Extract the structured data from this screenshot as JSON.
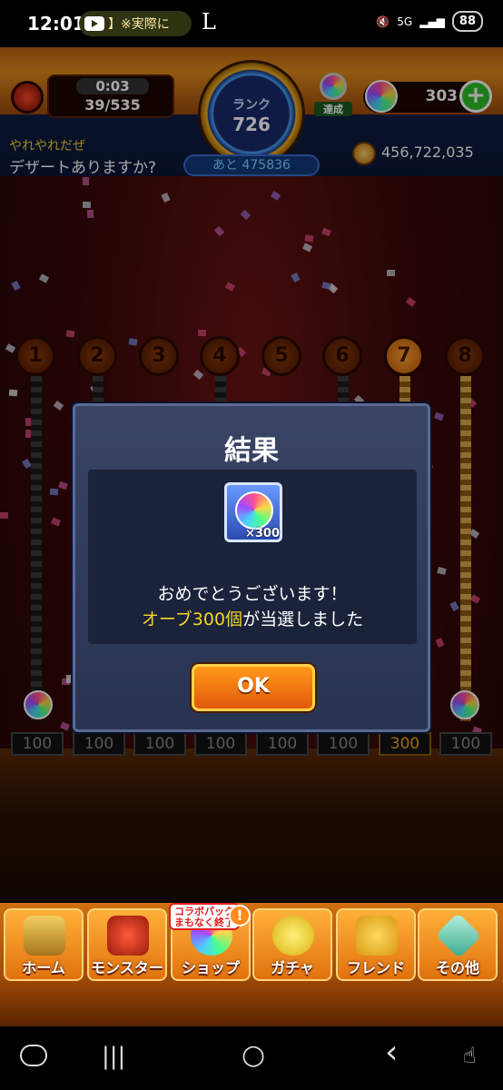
{
  "status_bar": {
    "time": "12:01",
    "notification_text": "】※実際に",
    "app_letter": "L",
    "network": "5G",
    "battery": "88"
  },
  "hud": {
    "stamina_timer": "0:03",
    "stamina": "39/535",
    "rank_label": "ランク",
    "rank": "726",
    "rank_next": "あと 475836",
    "achievement_label": "達成",
    "orbs": "303",
    "add_label": "+",
    "message_title": "やれやれだぜ",
    "message_text": "デザートありますか?",
    "gold": "456,722,035"
  },
  "board": {
    "slots": [
      "1",
      "2",
      "3",
      "4",
      "5",
      "6",
      "7",
      "8"
    ],
    "active_slot": "7",
    "prizes": [
      "100",
      "100",
      "100",
      "100",
      "100",
      "100",
      "300",
      "100"
    ]
  },
  "dialog": {
    "title": "結果",
    "reward_quantity": "×300",
    "congrats": "おめでとうございます！",
    "result_highlight": "オーブ300個",
    "result_rest": "が当選しました",
    "ok_label": "OK"
  },
  "nav": {
    "items": [
      {
        "label": "ホーム",
        "icon": "home-gate-icon"
      },
      {
        "label": "モンスター",
        "icon": "monster-dragon-icon"
      },
      {
        "label": "ショップ",
        "icon": "shop-orb-icon"
      },
      {
        "label": "ガチャ",
        "icon": "gacha-egg-icon"
      },
      {
        "label": "フレンド",
        "icon": "friend-people-icon"
      },
      {
        "label": "その他",
        "icon": "other-diamond-icon"
      }
    ],
    "shop_badge": "コラボパック まもなく終了",
    "shop_alert": "!"
  },
  "system_nav": {
    "recents": "|||",
    "home": "○",
    "back": "‹"
  },
  "colors": {
    "accent_orange": "#e2580a",
    "highlight_yellow": "#f6d52a",
    "dialog_bg": "#283352"
  }
}
